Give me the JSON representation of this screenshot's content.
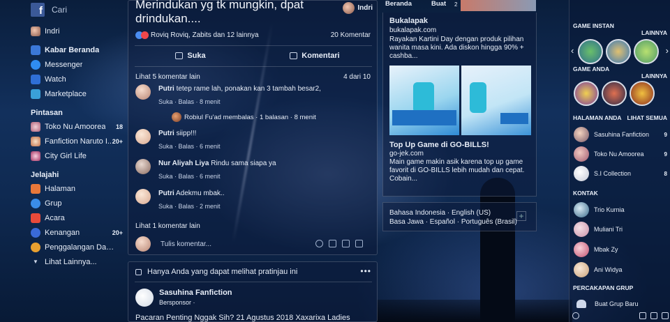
{
  "topbar": {
    "logo": "f",
    "search_label": "Cari"
  },
  "leftnav": {
    "profile": "Indri",
    "items": [
      {
        "label": "Kabar Beranda",
        "icon": "news-feed-icon",
        "color": "#3b78d8"
      },
      {
        "label": "Messenger",
        "icon": "messenger-icon",
        "color": "#2f8cf0"
      },
      {
        "label": "Watch",
        "icon": "watch-icon",
        "color": "#2f6fd6"
      },
      {
        "label": "Marketplace",
        "icon": "marketplace-icon",
        "color": "#3aa0d8"
      }
    ],
    "shortcuts_heading": "Pintasan",
    "shortcuts": [
      {
        "label": "Toko Nu Amoorea",
        "count": "18"
      },
      {
        "label": "Fanfiction Naruto I...",
        "count": "20+"
      },
      {
        "label": "City Girl Life",
        "count": ""
      }
    ],
    "explore_heading": "Jelajahi",
    "explore": [
      {
        "label": "Halaman",
        "icon": "flag-icon",
        "color": "#e8783a",
        "count": ""
      },
      {
        "label": "Grup",
        "icon": "groups-icon",
        "color": "#3a8ce8",
        "count": ""
      },
      {
        "label": "Acara",
        "icon": "calendar-icon",
        "color": "#e84a3a",
        "count": ""
      },
      {
        "label": "Kenangan",
        "icon": "memories-icon",
        "color": "#3a6ad8",
        "count": "20+"
      },
      {
        "label": "Penggalangan Dana",
        "icon": "fundraiser-icon",
        "color": "#e8a030",
        "count": ""
      }
    ],
    "see_more": "Lihat Lainnya..."
  },
  "post": {
    "title": "Merindukan yg tk mungkin, dpat drindukan....",
    "author_top": "Indri",
    "reactions": "Roviq Roviq, Zabits dan 12 lainnya",
    "comment_count": "20 Komentar",
    "like_label": "Suka",
    "comment_label": "Komentari",
    "view_more": "Lihat 5 komentar lain",
    "pager": "4 dari 10",
    "comments": [
      {
        "name": "Putri",
        "text": "tetep rame lah, ponakan kan 3 tambah besar2,",
        "meta": "Suka · Balas · 8 menit"
      },
      {
        "name": "Putri",
        "text": "siipp!!!",
        "meta": "Suka · Balas · 6 menit"
      },
      {
        "name": "Nur Aliyah Liya",
        "text": "Rindu sama siapa ya",
        "meta": "Suka · Balas · 6 menit"
      },
      {
        "name": "Putri",
        "text": "Adekmu mbak..",
        "meta": "Suka · Balas · 2 menit"
      }
    ],
    "reply_line": "Robiul Fu'ad membalas · 1 balasan · 8 menit",
    "view_more_2": "Lihat 1 komentar lain",
    "write_placeholder": "Tulis komentar..."
  },
  "card2": {
    "privacy": "Hanya Anda yang dapat melihat pratinjau ini",
    "dots": "•••",
    "sponsor_name": "Sasuhina Fanfiction",
    "sponsor_type": "Bersponsor ·",
    "text": "Pacaran Penting Nggak Sih? 21 Agustus 2018 Xaxarixa Ladies"
  },
  "rightcol": {
    "tabs": [
      "Beranda",
      "Buat"
    ],
    "badge": "2",
    "ad1": {
      "title": "Bukalapak",
      "url": "bukalapak.com",
      "desc": "Rayakan Kartini Day dengan produk pilihan wanita masa kini. Ada diskon hingga 90% + cashba..."
    },
    "ad2": {
      "title": "Top Up Game di GO-BILLS!",
      "url": "go-jek.com",
      "desc": "Main game makin asik karena top up game favorit di GO-BILLS lebih mudah dan cepat. Cobain..."
    },
    "lang_line1": "Bahasa Indonesia · English (US)",
    "lang_line2": "Basa Jawa · Español · Português (Brasil)",
    "lang_plus": "+"
  },
  "sidebar": {
    "instant_games": "GAME INSTAN",
    "more": "LAINNYA",
    "your_games": "GAME ANDA",
    "your_pages": "HALAMAN ANDA",
    "see_all": "LIHAT SEMUA",
    "pages": [
      {
        "label": "Sasuhina Fanfiction",
        "count": "9"
      },
      {
        "label": "Toko Nu Amoorea",
        "count": "9"
      },
      {
        "label": "S.I Collection",
        "count": "8"
      }
    ],
    "contacts_heading": "KONTAK",
    "contacts": [
      "Trio Kurnia",
      "Muliani Tri",
      "Mbak Zy",
      "Ani Widya"
    ],
    "groups_heading": "PERCAKAPAN GRUP",
    "new_group": "Buat Grup Baru"
  }
}
